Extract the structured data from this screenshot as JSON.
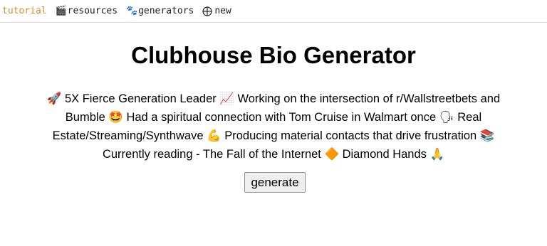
{
  "nav": {
    "items": [
      {
        "label": "tutorial",
        "icon": "",
        "active": true
      },
      {
        "label": "resources",
        "icon": "clapperboard-icon",
        "active": false
      },
      {
        "label": "generators",
        "icon": "paw-icon",
        "active": false
      },
      {
        "label": "new",
        "icon": "globe-icon",
        "active": false
      }
    ],
    "active_color": "#d38e2a"
  },
  "page": {
    "title": "Clubhouse Bio Generator",
    "bio": "🚀 5X Fierce Generation Leader 📈 Working on the intersection of r/Wallstreetbets and Bumble 🤩 Had a spiritual connection with Tom Cruise in Walmart once 🗣 Real Estate/Streaming/Synthwave 💪 Producing material contacts that drive frustration 📚 Currently reading - The Fall of the Internet 🔶 Diamond Hands 🙏",
    "generate_label": "generate"
  }
}
